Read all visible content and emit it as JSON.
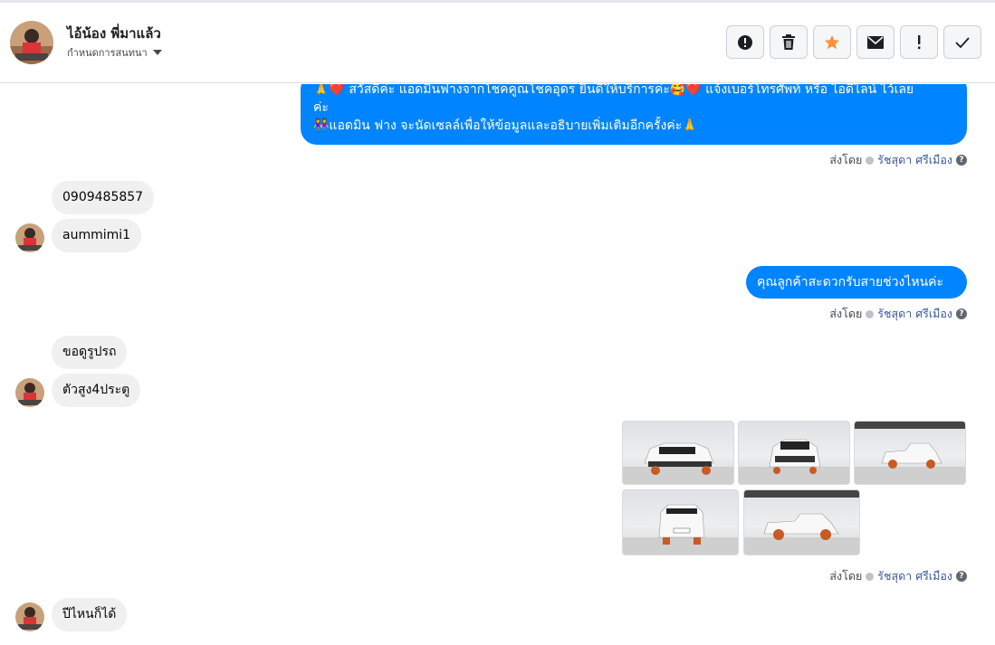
{
  "header": {
    "contact_name": "ไอ้น้อง พี่มาแล้ว",
    "assign_label": "กำหนดการสนทนา",
    "avatar_icon": "user-avatar",
    "actions": [
      {
        "name": "report-spam-button",
        "icon": "alert-circle-icon"
      },
      {
        "name": "delete-button",
        "icon": "trash-icon"
      },
      {
        "name": "star-button",
        "icon": "star-icon",
        "color": "#f7923a"
      },
      {
        "name": "mark-unread-button",
        "icon": "envelope-icon"
      },
      {
        "name": "follow-up-button",
        "icon": "exclamation-icon"
      },
      {
        "name": "mark-done-button",
        "icon": "check-icon"
      }
    ]
  },
  "colors": {
    "outgoing_bubble": "#0084ff",
    "incoming_bubble": "#f0f0f0",
    "agent_link": "#385898"
  },
  "messages": {
    "out_1": {
      "line1": "🙏❤️ สวัสดีค่ะ แอดมินฟางจากโชคคูณโชคอุดร ยินดีให้บริการค่ะ🥰❤️ แจ้งเบอร์โทรศัพท์ หรือ ไอดีไลน์  ไว้เลย",
      "line2": "ค่ะ",
      "line3": "👭แอดมิน ฟาง จะนัดเซลล์เพื่อให้ข้อมูลและอธิบายเพิ่มเติมอีกครั้งค่ะ🙏"
    },
    "in_1": "0909485857",
    "in_2": "aummimi1",
    "out_2": "คุณลูกค้าสะดวกรับสายช่วงไหนค่ะ",
    "in_3": "ขอดูรูปรถ",
    "in_4": "ตัวสูง4ประตู",
    "in_5": "ปีไหนก็ได้",
    "photo_count": 5
  },
  "sent_by": {
    "label": "ส่งโดย",
    "agent": "รัชสุดา ศรีเมือง",
    "help": "?"
  }
}
